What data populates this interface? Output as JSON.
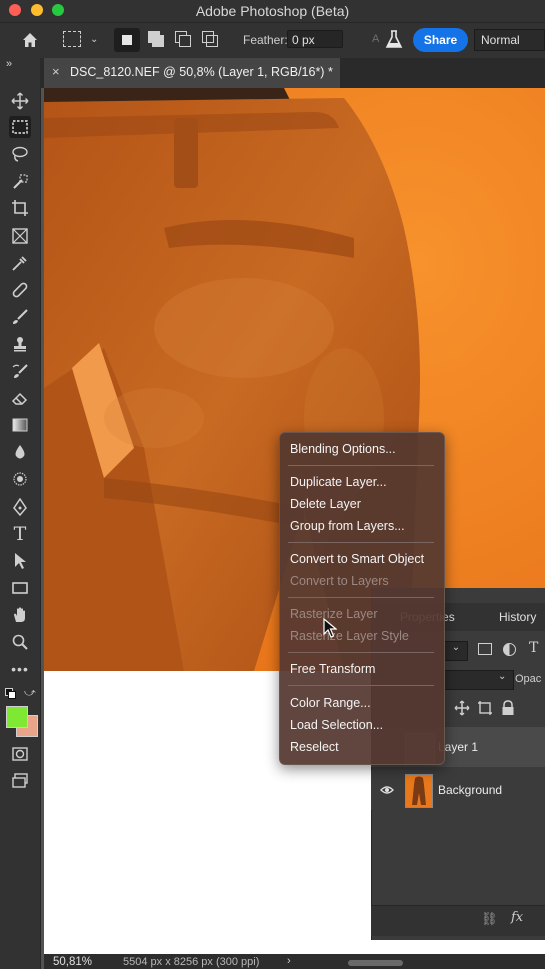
{
  "app": {
    "title": "Adobe Photoshop (Beta)",
    "colors": {
      "close": "#fe5f57",
      "minimize": "#febc2e",
      "maximize": "#28c840",
      "accent": "#1473e6"
    }
  },
  "options_bar": {
    "feather_label": "Feather:",
    "feather_value": "0 px",
    "antialias_label": "A",
    "share_label": "Share",
    "mode_value": "Normal"
  },
  "document": {
    "tab_title": "DSC_8120.NEF @ 50,8% (Layer 1, RGB/16*) *",
    "close_glyph": "×"
  },
  "status_bar": {
    "zoom": "50,81%",
    "doc_size": "5504 px x 8256 px (300 ppi)"
  },
  "panels": {
    "tab_properties": "Properties",
    "tab_history": "History",
    "opacity_label": "Opac",
    "layers": [
      {
        "name": "Layer 1",
        "visible": false
      },
      {
        "name": "Background",
        "visible": true
      }
    ],
    "fx_label": "fx"
  },
  "swatches": {
    "foreground": "#7ee832",
    "background": "#e8a58a"
  },
  "context_menu": {
    "items": [
      {
        "label": "Blending Options...",
        "enabled": true
      },
      {
        "label": "Duplicate Layer...",
        "enabled": true
      },
      {
        "label": "Delete Layer",
        "enabled": true
      },
      {
        "label": "Group from Layers...",
        "enabled": true
      },
      {
        "label": "Convert to Smart Object",
        "enabled": true
      },
      {
        "label": "Convert to Layers",
        "enabled": false
      },
      {
        "label": "Rasterize Layer",
        "enabled": false
      },
      {
        "label": "Rasterize Layer Style",
        "enabled": false
      },
      {
        "label": "Free Transform",
        "enabled": true
      },
      {
        "label": "Color Range...",
        "enabled": true
      },
      {
        "label": "Load Selection...",
        "enabled": true
      },
      {
        "label": "Reselect",
        "enabled": true
      }
    ]
  }
}
